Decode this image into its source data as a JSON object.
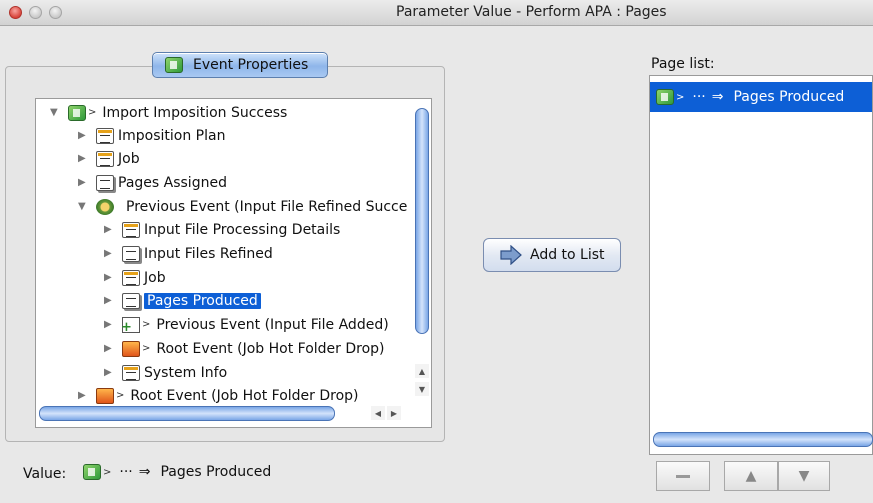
{
  "window": {
    "title": "Parameter Value - Perform APA : Pages"
  },
  "event_properties": {
    "tab_label": "Event Properties",
    "tree": [
      {
        "label": "Import Imposition Success",
        "icon": "green-event-icon",
        "expanded": true
      },
      {
        "label": "Imposition Plan",
        "icon": "document-icon"
      },
      {
        "label": "Job",
        "icon": "document-icon"
      },
      {
        "label": "Pages Assigned",
        "icon": "pages-icon"
      },
      {
        "label": "Previous Event (Input File Refined Succe",
        "icon": "gear-event-icon",
        "expanded": true
      },
      {
        "label": "Input File Processing Details",
        "icon": "document-icon"
      },
      {
        "label": "Input Files Refined",
        "icon": "pages-icon"
      },
      {
        "label": "Job",
        "icon": "document-icon"
      },
      {
        "label": "Pages Produced",
        "icon": "pages-icon",
        "selected": true
      },
      {
        "label": "Previous Event (Input File Added)",
        "icon": "add-file-icon"
      },
      {
        "label": "Root Event (Job Hot Folder Drop)",
        "icon": "folder-icon"
      },
      {
        "label": "System Info",
        "icon": "document-icon"
      },
      {
        "label": "Root Event (Job Hot Folder Drop)",
        "icon": "folder-icon"
      }
    ]
  },
  "add_button": {
    "label": "Add to List"
  },
  "page_list": {
    "label": "Page list:",
    "items": [
      {
        "dots": "···",
        "arrow": "⇒",
        "label": "Pages Produced",
        "selected": true
      }
    ]
  },
  "value": {
    "label": "Value:",
    "dots": "···",
    "arrow": "⇒",
    "text": "Pages Produced"
  },
  "colors": {
    "selection": "#0d5fd6",
    "tab_fill": "#8fb6ea"
  }
}
